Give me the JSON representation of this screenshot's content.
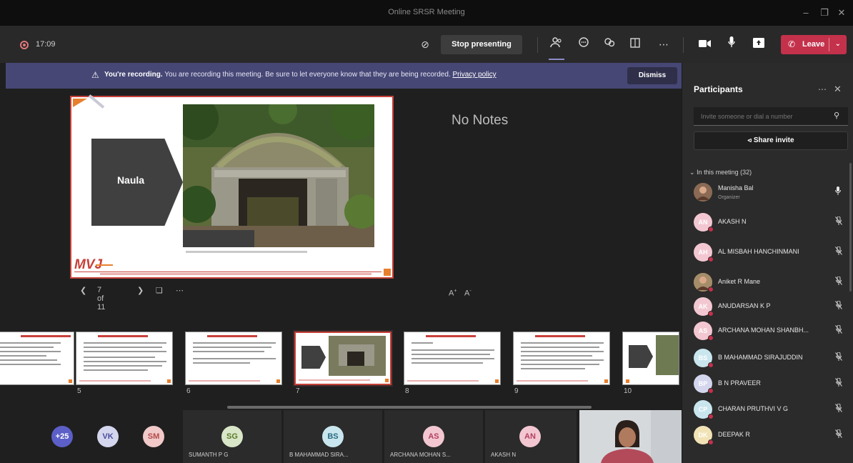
{
  "window": {
    "title": "Online SRSR Meeting"
  },
  "toolbar": {
    "timer": "17:09",
    "stop_presenting_label": "Stop presenting",
    "leave_label": "Leave"
  },
  "banner": {
    "heading": "You're recording.",
    "message": "You are recording this meeting. Be sure to let everyone know that they are being recorded.",
    "privacy_link": "Privacy policy",
    "dismiss_label": "Dismiss"
  },
  "slide": {
    "box_label": "Naula",
    "notes_text": "No Notes",
    "counter": "7 of 11"
  },
  "thumbnails": [
    {
      "num": ""
    },
    {
      "num": "5"
    },
    {
      "num": "6"
    },
    {
      "num": "7"
    },
    {
      "num": "8"
    },
    {
      "num": "9"
    },
    {
      "num": "10"
    }
  ],
  "gallery": {
    "overflow_count": "+25",
    "avatars": [
      {
        "initials": "VK",
        "color": "#d4d6ee"
      },
      {
        "initials": "SM",
        "color": "#f1c9c9"
      }
    ],
    "tiles": [
      {
        "initials": "SG",
        "name": "SUMANTH P G",
        "color": "#d9e6c7"
      },
      {
        "initials": "BS",
        "name": "B MAHAMMAD SIRA...",
        "color": "#c9e6ee"
      },
      {
        "initials": "AS",
        "name": "ARCHANA MOHAN S...",
        "color": "#f3c7d2"
      },
      {
        "initials": "AN",
        "name": "AKASH N",
        "color": "#f3c7d2"
      }
    ]
  },
  "participants": {
    "title": "Participants",
    "invite_placeholder": "Invite someone or dial a number",
    "share_invite_label": "Share invite",
    "in_meeting_label": "In this meeting (32)",
    "people": [
      {
        "initials": "",
        "name": "Manisha Bal",
        "role": "Organizer",
        "color": "#8a6a55"
      },
      {
        "initials": "AN",
        "name": "AKASH N",
        "role": "",
        "color": "#f3c7d2"
      },
      {
        "initials": "AH",
        "name": "AL MISBAH HANCHINMANI",
        "role": "",
        "color": "#f3c7d2"
      },
      {
        "initials": "",
        "name": "Aniket R Mane",
        "role": "",
        "color": "#a58d6a"
      },
      {
        "initials": "AK",
        "name": "ANUDARSAN K P",
        "role": "",
        "color": "#f3c7d2"
      },
      {
        "initials": "AS",
        "name": "ARCHANA MOHAN SHANBH...",
        "role": "",
        "color": "#f3c7d2"
      },
      {
        "initials": "BS",
        "name": "B MAHAMMAD SIRAJUDDIN",
        "role": "",
        "color": "#c9e6ee"
      },
      {
        "initials": "BP",
        "name": "B N PRAVEER",
        "role": "",
        "color": "#d4d6ee"
      },
      {
        "initials": "CP",
        "name": "CHARAN PRUTHVI V G",
        "role": "",
        "color": "#c9e6ee"
      },
      {
        "initials": "DK",
        "name": "DEEPAK R",
        "role": "",
        "color": "#f1e3b5"
      }
    ]
  }
}
